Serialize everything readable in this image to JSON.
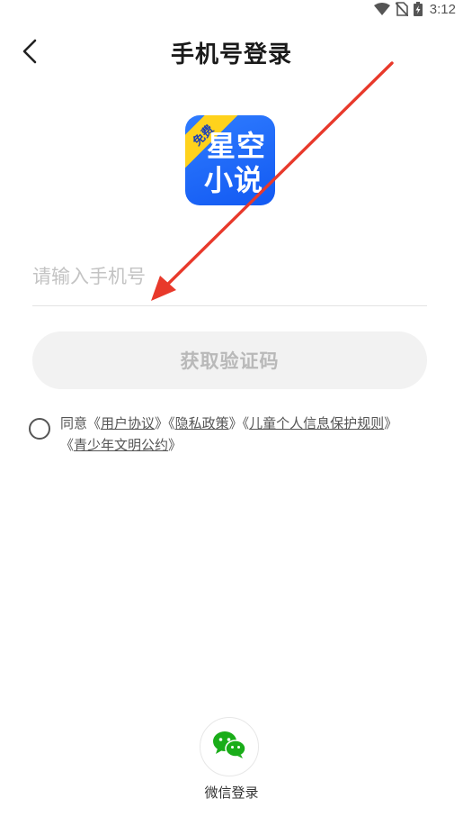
{
  "status_bar": {
    "time": "3:12",
    "icons": [
      "wifi-icon",
      "no-sim-icon",
      "battery-charging-icon"
    ]
  },
  "header": {
    "back_icon": "chevron-left-icon",
    "title": "手机号登录"
  },
  "logo": {
    "badge": "免费",
    "line1": "星空",
    "line2": "小说",
    "colors": {
      "background": "#1c66f7",
      "badge": "#ffd21c",
      "text": "#ffffff"
    }
  },
  "phone_input": {
    "placeholder": "请输入手机号",
    "value": ""
  },
  "get_code_button": {
    "label": "获取验证码"
  },
  "agreement": {
    "prefix": "同意",
    "open": "《",
    "close": "》",
    "links": [
      "用户协议",
      "隐私政策",
      "儿童个人信息保护规则",
      "青少年文明公约"
    ]
  },
  "wechat": {
    "icon": "wechat-icon",
    "label": "微信登录",
    "color": "#1aad19"
  },
  "annotation": {
    "arrow_color": "#e8392b"
  }
}
